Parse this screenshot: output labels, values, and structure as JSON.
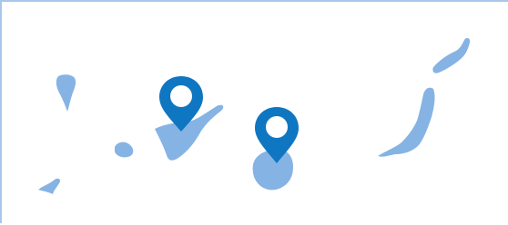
{
  "map": {
    "colors": {
      "island": "#85b3e4",
      "pin": "#0f76c1",
      "border": "#a9c7ea",
      "background": "#ffffff"
    },
    "islands": [
      "la-palma",
      "el-hierro",
      "la-gomera",
      "tenerife",
      "gran-canaria",
      "fuerteventura",
      "lanzarote"
    ],
    "markers": [
      {
        "icon": "map-pin-icon",
        "on": "tenerife"
      },
      {
        "icon": "map-pin-icon",
        "on": "gran-canaria"
      }
    ]
  }
}
